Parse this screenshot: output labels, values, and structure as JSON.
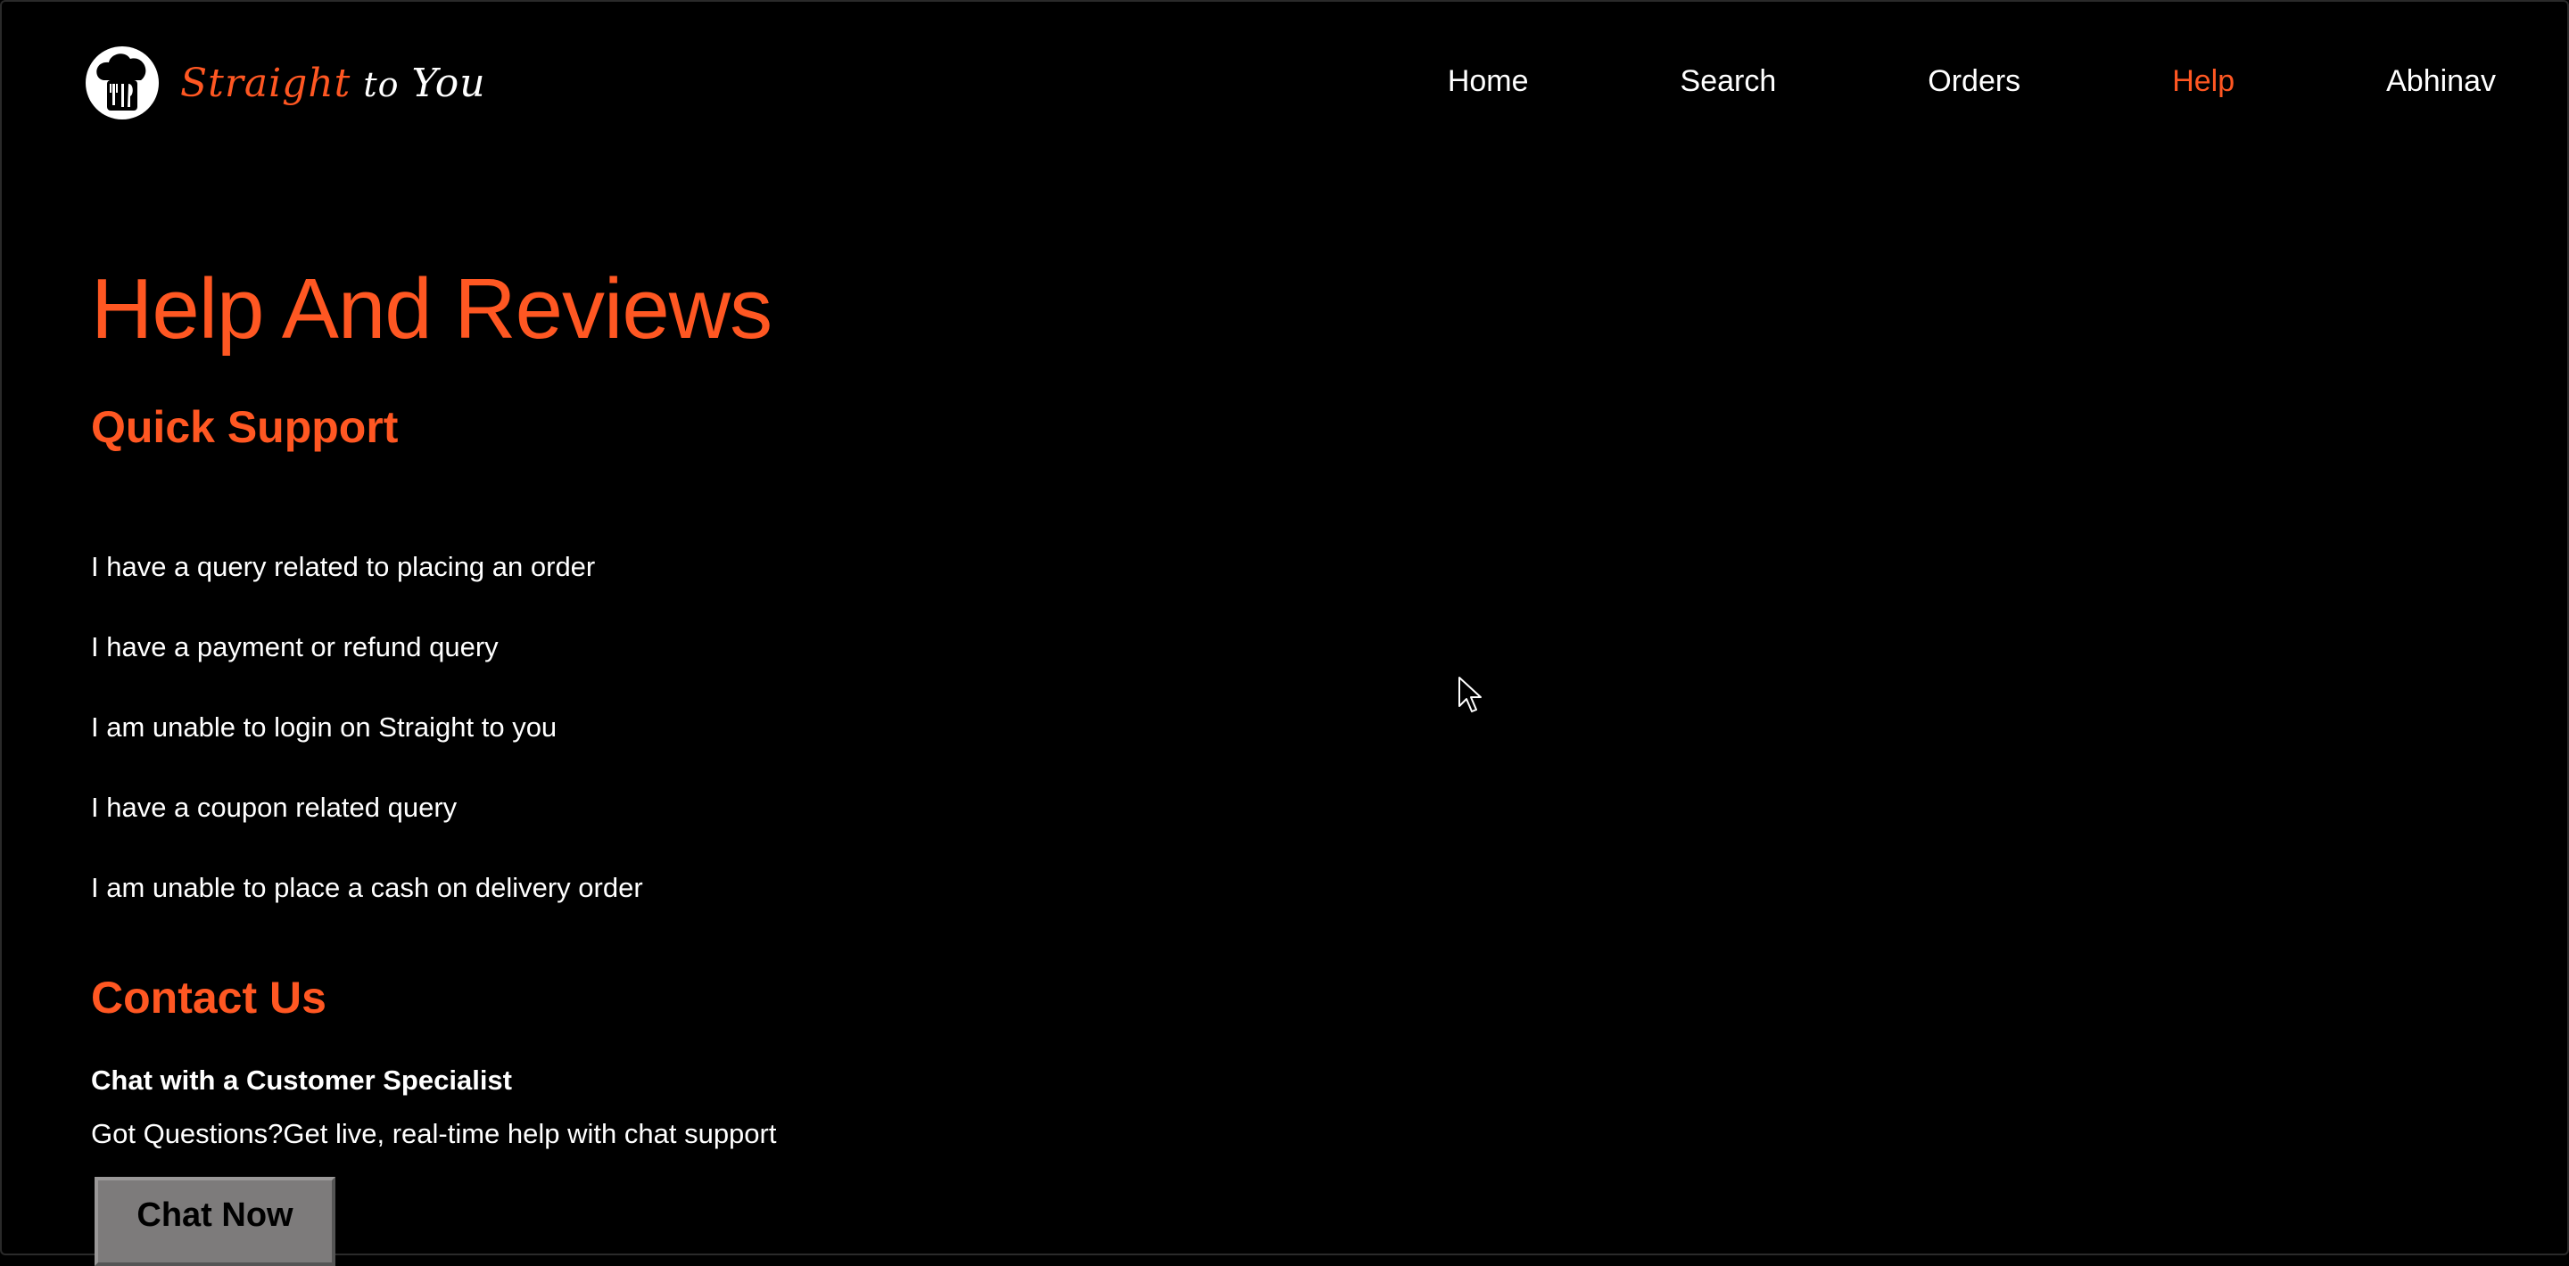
{
  "brand": {
    "word1": "Straight",
    "word2": "to",
    "word3": "You",
    "icon": "chef-hat-utensils-icon"
  },
  "nav": {
    "items": [
      {
        "label": "Home"
      },
      {
        "label": "Search"
      },
      {
        "label": "Orders"
      },
      {
        "label": "Help"
      },
      {
        "label": "Abhinav"
      }
    ],
    "active": "Help"
  },
  "page": {
    "title": "Help And Reviews"
  },
  "quick_support": {
    "title": "Quick Support",
    "items": [
      {
        "label": "I have a query related to placing an order"
      },
      {
        "label": "I have a payment or refund query"
      },
      {
        "label": "I am unable to login on Straight to you"
      },
      {
        "label": "I have a coupon related query"
      },
      {
        "label": "I am unable to place a cash on delivery order"
      }
    ]
  },
  "contact": {
    "title": "Contact Us",
    "specialist_title": "Chat with a Customer Specialist",
    "specialist_desc": "Got Questions?Get live, real-time help with chat support",
    "chat_button": "Chat Now"
  },
  "colors": {
    "accent": "#ff5722",
    "background": "#000000",
    "text": "#ffffff",
    "button": "#7d7b7b"
  }
}
